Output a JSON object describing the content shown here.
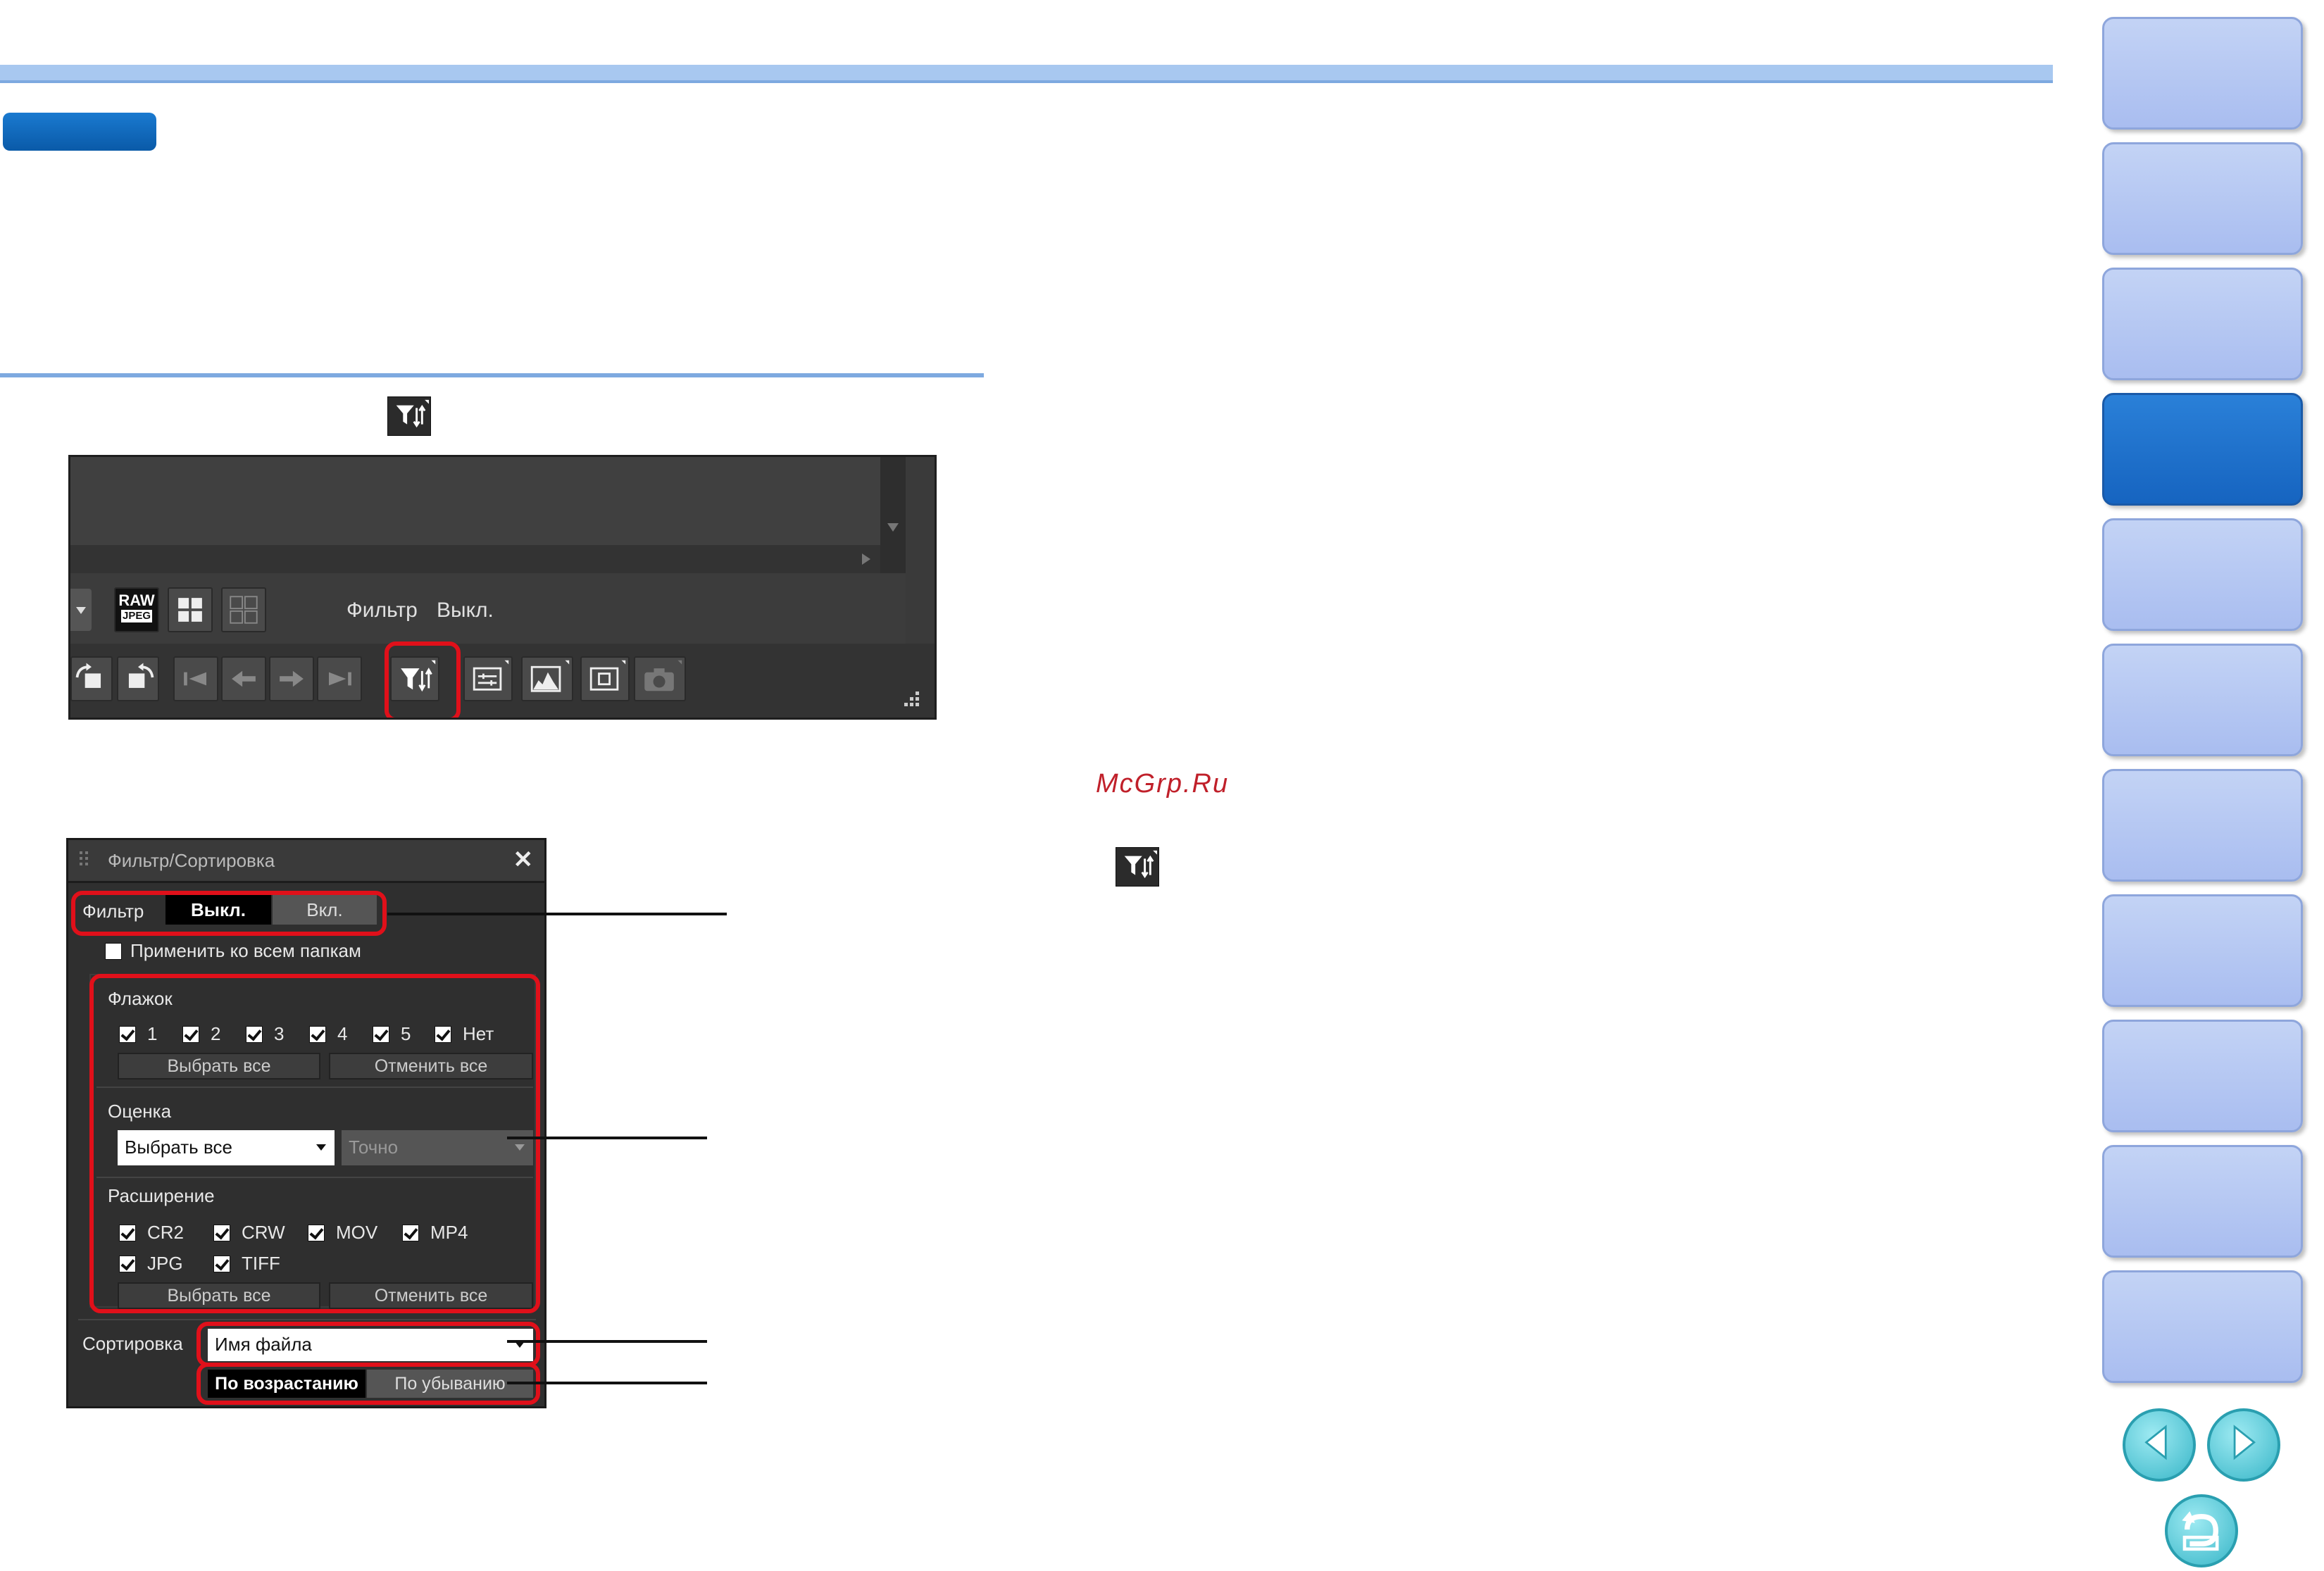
{
  "watermark": "McGrp.Ru",
  "screenshot1": {
    "raw_badge_top": "RAW",
    "raw_badge_bottom": "JPEG",
    "filter_label": "Фильтр",
    "filter_status": "Выкл."
  },
  "panel": {
    "title": "Фильтр/Сортировка",
    "close_glyph": "✕",
    "filter_label": "Фильтр",
    "filter_off": "Выкл.",
    "filter_on": "Вкл.",
    "apply_all_label": "Применить ко всем папкам",
    "flag_header": "Флажок",
    "flags": [
      "1",
      "2",
      "3",
      "4",
      "5",
      "Нет"
    ],
    "select_all": "Выбрать все",
    "deselect_all": "Отменить все",
    "rating_header": "Оценка",
    "rating_value": "Выбрать все",
    "rating_mode": "Точно",
    "ext_header": "Расширение",
    "extensions": [
      "CR2",
      "CRW",
      "MOV",
      "MP4",
      "JPG",
      "TIFF"
    ],
    "sort_label": "Сортировка",
    "sort_value": "Имя файла",
    "ascending": "По возрастанию",
    "descending": "По убыванию"
  },
  "nav": {
    "button_count": 11,
    "active_index": 3
  },
  "colors": {
    "accent_blue": "#1a7ad0",
    "highlight_red": "#e0101a",
    "nav_inactive": "#b8caf2",
    "nav_active": "#1e70c8"
  }
}
